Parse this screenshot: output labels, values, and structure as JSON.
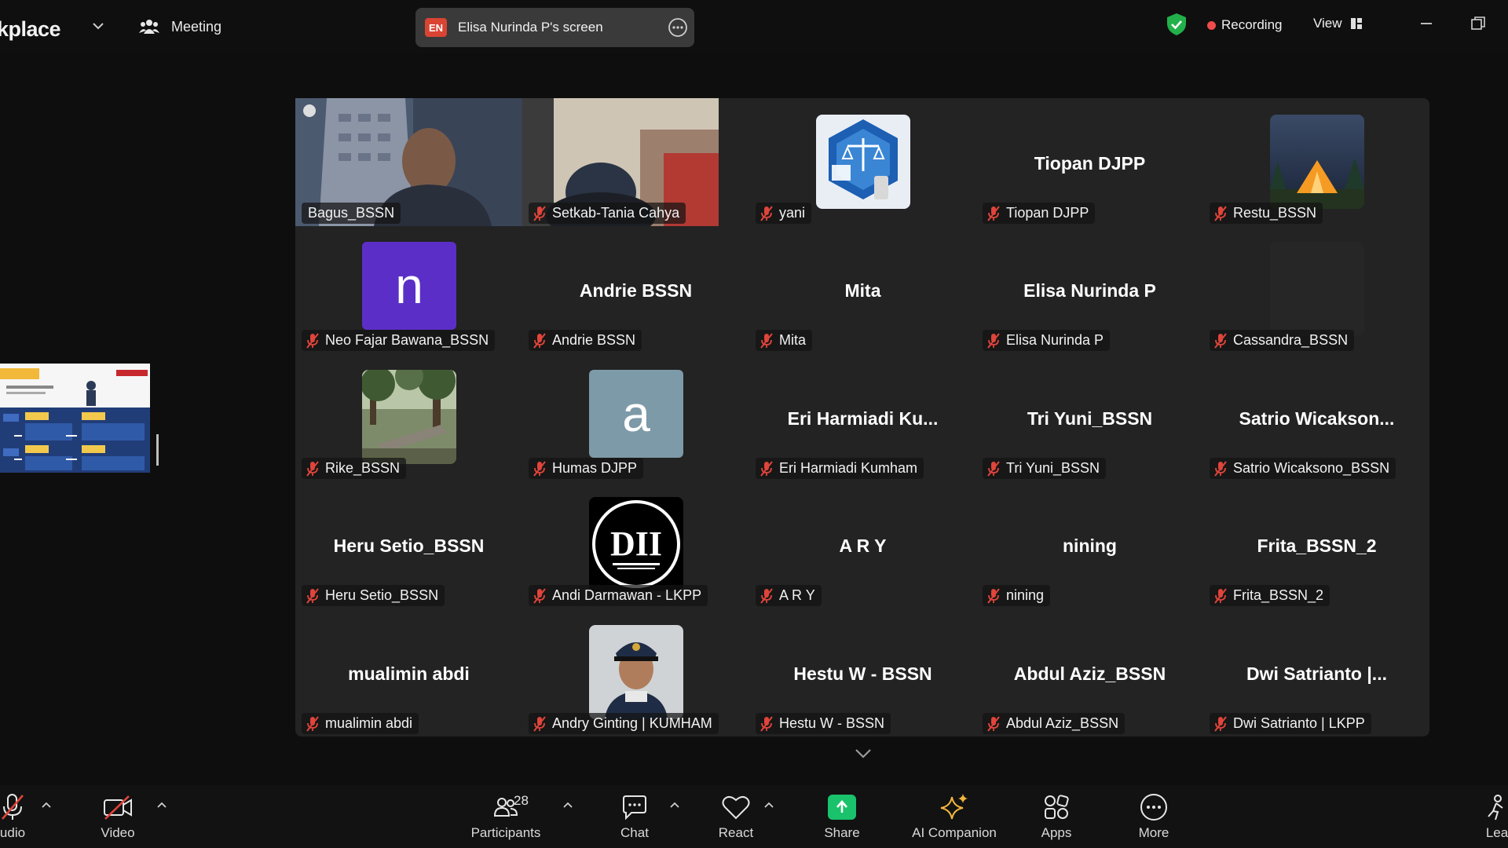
{
  "topbar": {
    "app_title": "kplace",
    "meeting_label": "Meeting",
    "screen_share": {
      "lang_badge": "EN",
      "title": "Elisa Nurinda P's screen"
    },
    "recording_label": "Recording",
    "view_label": "View"
  },
  "participants": [
    {
      "label": "Bagus_BSSN",
      "muted": false,
      "kind": "video",
      "active": true
    },
    {
      "label": "Setkab-Tania Cahya",
      "muted": true,
      "kind": "video"
    },
    {
      "label": "yani",
      "muted": true,
      "kind": "picture",
      "picture": "justice-scales-icon"
    },
    {
      "label": "Tiopan DJPP",
      "muted": true,
      "kind": "name",
      "display": "Tiopan DJPP"
    },
    {
      "label": "Restu_BSSN",
      "muted": true,
      "kind": "picture",
      "picture": "tent-night-photo"
    },
    {
      "label": "Neo Fajar Bawana_BSSN",
      "muted": true,
      "kind": "letter",
      "letter": "n",
      "color": "#5b2fc7"
    },
    {
      "label": "Andrie BSSN",
      "muted": true,
      "kind": "name",
      "display": "Andrie BSSN"
    },
    {
      "label": "Mita",
      "muted": true,
      "kind": "name",
      "display": "Mita"
    },
    {
      "label": "Elisa Nurinda P",
      "muted": true,
      "kind": "name",
      "display": "Elisa Nurinda P"
    },
    {
      "label": "Cassandra_BSSN",
      "muted": true,
      "kind": "dark"
    },
    {
      "label": "Rike_BSSN",
      "muted": true,
      "kind": "picture",
      "picture": "park-bench-photo"
    },
    {
      "label": "Humas DJPP",
      "muted": true,
      "kind": "letter",
      "letter": "a",
      "color": "#7d9aa8"
    },
    {
      "label": "Eri Harmiadi Kumham",
      "muted": true,
      "kind": "name",
      "display": "Eri  Harmiadi  Ku..."
    },
    {
      "label": "Tri Yuni_BSSN",
      "muted": true,
      "kind": "name",
      "display": "Tri Yuni_BSSN"
    },
    {
      "label": "Satrio Wicaksono_BSSN",
      "muted": true,
      "kind": "name",
      "display": "Satrio  Wicakson..."
    },
    {
      "label": "Heru Setio_BSSN",
      "muted": true,
      "kind": "name",
      "display": "Heru Setio_BSSN"
    },
    {
      "label": "Andi Darmawan - LKPP",
      "muted": true,
      "kind": "picture",
      "picture": "dit-logo"
    },
    {
      "label": "A R Y",
      "muted": true,
      "kind": "name",
      "display": "A R Y"
    },
    {
      "label": "nining",
      "muted": true,
      "kind": "name",
      "display": "nining"
    },
    {
      "label": "Frita_BSSN_2",
      "muted": true,
      "kind": "name",
      "display": "Frita_BSSN_2"
    },
    {
      "label": "mualimin abdi",
      "muted": true,
      "kind": "name",
      "display": "mualimin abdi"
    },
    {
      "label": "Andry Ginting | KUMHAM",
      "muted": true,
      "kind": "picture",
      "picture": "officer-portrait"
    },
    {
      "label": "Hestu W - BSSN",
      "muted": true,
      "kind": "name",
      "display": "Hestu W - BSSN"
    },
    {
      "label": "Abdul Aziz_BSSN",
      "muted": true,
      "kind": "name",
      "display": "Abdul Aziz_BSSN"
    },
    {
      "label": "Dwi Satrianto | LKPP",
      "muted": true,
      "kind": "name",
      "display": "Dwi Satrianto  |..."
    }
  ],
  "toolbar": {
    "audio_label": "udio",
    "video_label": "Video",
    "participants_label": "Participants",
    "participants_count": "28",
    "chat_label": "Chat",
    "react_label": "React",
    "share_label": "Share",
    "ai_label": "AI Companion",
    "apps_label": "Apps",
    "more_label": "More",
    "leave_label": "Lea"
  },
  "colors": {
    "active_border": "#22c55e",
    "share_green": "#19c26b",
    "recording_red": "#f04b4b",
    "mute_red": "#e0443a"
  }
}
